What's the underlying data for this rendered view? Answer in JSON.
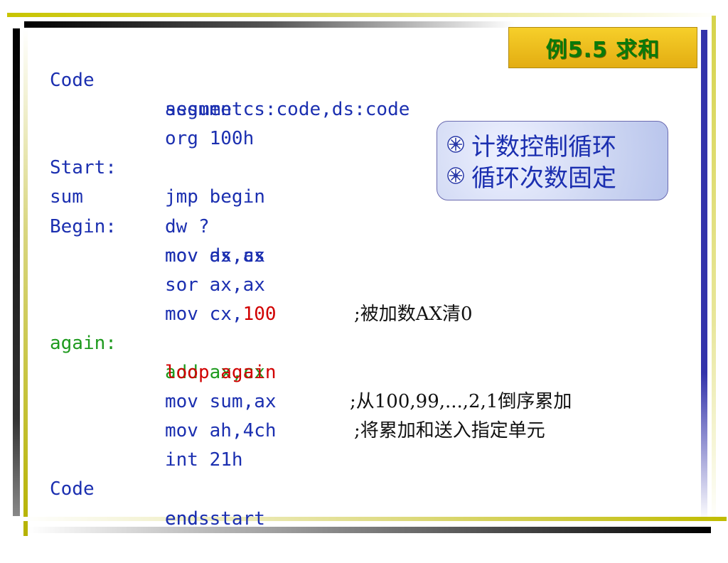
{
  "title": "例5.5 求和",
  "notes": [
    "计数控制循环",
    "循环次数固定"
  ],
  "note_icon": "starburst-bullet-icon",
  "colors": {
    "code": "#1b2fb0",
    "label_green": "#1e9a1e",
    "highlight_red": "#d10000",
    "title_green": "#0a7a0a",
    "title_bg": "#f2c42a"
  },
  "code": {
    "l1": {
      "label": "Code",
      "instr": "segment"
    },
    "l2": {
      "instr": "assume cs:code,ds:code"
    },
    "l3": {
      "instr": "org 100h"
    },
    "l4": {
      "label": "Start:",
      "instr": "jmp begin"
    },
    "l5": {
      "label": "sum",
      "instr": "dw ?"
    },
    "l6": {
      "label": "Begin:",
      "instr": "mov ax,cs"
    },
    "l7": {
      "instr": "mov ds,ax"
    },
    "l8": {
      "instr": "sor ax,ax",
      "comment": ";被加数AX清0"
    },
    "l9": {
      "instr": "mov cx,",
      "instr_value": "100"
    },
    "l10": {
      "label": "again:",
      "instr": "add ax,cx",
      "comment": ";从100,99,...,2,1倒序累加"
    },
    "l11": {
      "instr": "loop again"
    },
    "l12": {
      "instr": "mov sum,ax",
      "comment": ";将累加和送入指定单元"
    },
    "l13": {
      "instr": "mov ah,4ch"
    },
    "l14": {
      "instr": "int 21h"
    },
    "l15": {
      "label": "Code",
      "instr": "ends"
    },
    "l16": {
      "instr": "end start"
    }
  }
}
